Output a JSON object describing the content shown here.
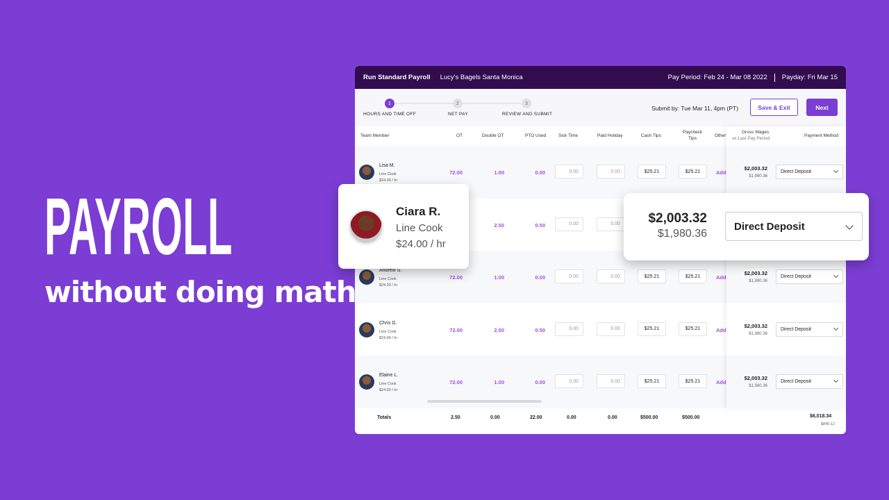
{
  "hero": {
    "title": "PAYROLL",
    "subtitle": "without doing math."
  },
  "topbar": {
    "title": "Run Standard Payroll",
    "company": "Lucy's Bagels Santa Monica",
    "pay_period": "Pay Period: Feb 24 - Mar 08 2022",
    "payday": "Payday: Fri Mar 15"
  },
  "steps": [
    {
      "num": "1",
      "label": "HOURS AND TIME OFF",
      "active": true
    },
    {
      "num": "2",
      "label": "NET PAY",
      "active": false
    },
    {
      "num": "3",
      "label": "REVIEW AND SUBMIT",
      "active": false
    }
  ],
  "submit_by": "Submit by: Tue Mar 11, 4pm (PT)",
  "buttons": {
    "save": "Save & Exit",
    "next": "Next"
  },
  "columns": {
    "member": "Team Member",
    "ot": "OT",
    "dot": "Double OT",
    "pto": "PTO Used",
    "sick": "Sick Time",
    "holiday": "Paid Holiday",
    "cash": "Cash Tips",
    "paycheck1": "Paycheck",
    "paycheck2": "Tips",
    "other": "Other",
    "gross": "Gross Wages",
    "gross_sub": "vs Last Pay Period",
    "payment": "Payment Method"
  },
  "rows": [
    {
      "name": "Lisa M.",
      "role": "Line Cook",
      "rate": "$24.00 / hr",
      "ot": "72.00",
      "dot": "1.00",
      "pto": "0.00",
      "sick": "0.00",
      "holiday": "0.00",
      "cash": "$25.21",
      "paycheck": "$25.21",
      "other": "Add",
      "gross": "$2,003.32",
      "last": "$1,980.36",
      "payment": "Direct Deposit"
    },
    {
      "name": "Ciara R.",
      "role": "Line Cook",
      "rate": "$24.00 / hr",
      "ot": "",
      "dot": "2.50",
      "pto": "0.50",
      "sick": "0.00",
      "holiday": "0.00",
      "cash": "",
      "paycheck": "",
      "other": "",
      "gross": "",
      "last": "",
      "payment": ""
    },
    {
      "name": "Andrew S.",
      "role": "Line Cook",
      "rate": "$24.00 / hr",
      "ot": "72.00",
      "dot": "1.00",
      "pto": "0.00",
      "sick": "0.00",
      "holiday": "0.00",
      "cash": "$25.21",
      "paycheck": "$25.21",
      "other": "Add",
      "gross": "$2,003.32",
      "last": "$1,980.36",
      "payment": "Direct Deposit"
    },
    {
      "name": "Chris G.",
      "role": "Line Cook",
      "rate": "$24.00 / hr",
      "ot": "72.00",
      "dot": "2.50",
      "pto": "0.50",
      "sick": "0.00",
      "holiday": "0.00",
      "cash": "$25.21",
      "paycheck": "$25.21",
      "other": "Add",
      "gross": "$2,003.32",
      "last": "$1,980.36",
      "payment": "Direct Deposit"
    },
    {
      "name": "Elaine L.",
      "role": "Line Cook",
      "rate": "$24.00 / hr",
      "ot": "72.00",
      "dot": "1.00",
      "pto": "0.00",
      "sick": "0.00",
      "holiday": "0.00",
      "cash": "$25.21",
      "paycheck": "$25.21",
      "other": "Add",
      "gross": "$2,003.32",
      "last": "$1,980.36",
      "payment": "Direct Deposit"
    }
  ],
  "totals": {
    "label": "Totals",
    "ot": "2.50",
    "dot": "0.00",
    "pto": "22.00",
    "sick": "0.00",
    "holiday": "0.00",
    "cash": "$500.00",
    "paycheck": "$500.00",
    "gross": "$6,018.34",
    "last": "$840.12"
  },
  "callout_member": {
    "name": "Ciara R.",
    "role": "Line Cook",
    "rate": "$24.00 / hr"
  },
  "callout_pay": {
    "gross": "$2,003.32",
    "last": "$1,980.36",
    "payment": "Direct Deposit"
  },
  "colors": {
    "background": "#7b3dd4",
    "topbar": "#330b4f",
    "accent": "#a24de8"
  }
}
